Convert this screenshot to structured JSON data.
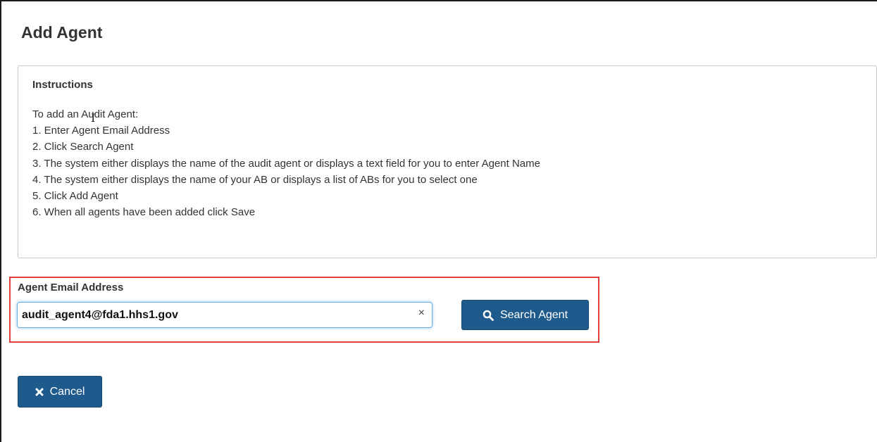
{
  "page": {
    "title": "Add Agent"
  },
  "instructions": {
    "heading": "Instructions",
    "lines": [
      "To add an Audit Agent:",
      "1. Enter Agent Email Address",
      "2. Click Search Agent",
      "3. The system either displays the name of the audit agent or displays a text field for you to enter Agent Name",
      "4. The system either displays the name of your AB or displays a list of ABs for you to select one",
      "5. Click Add Agent",
      "6. When all agents have been added click Save"
    ]
  },
  "search": {
    "label": "Agent Email Address",
    "value": "audit_agent4@fda1.hhs1.gov",
    "clear_glyph": "×",
    "button_label": "Search Agent",
    "button_icon": "search-icon"
  },
  "actions": {
    "cancel_label": "Cancel",
    "cancel_icon": "close-icon"
  },
  "colors": {
    "primary_button": "#1f5a8c",
    "highlight_border": "#e0413d",
    "focus_border": "#66afe9"
  }
}
